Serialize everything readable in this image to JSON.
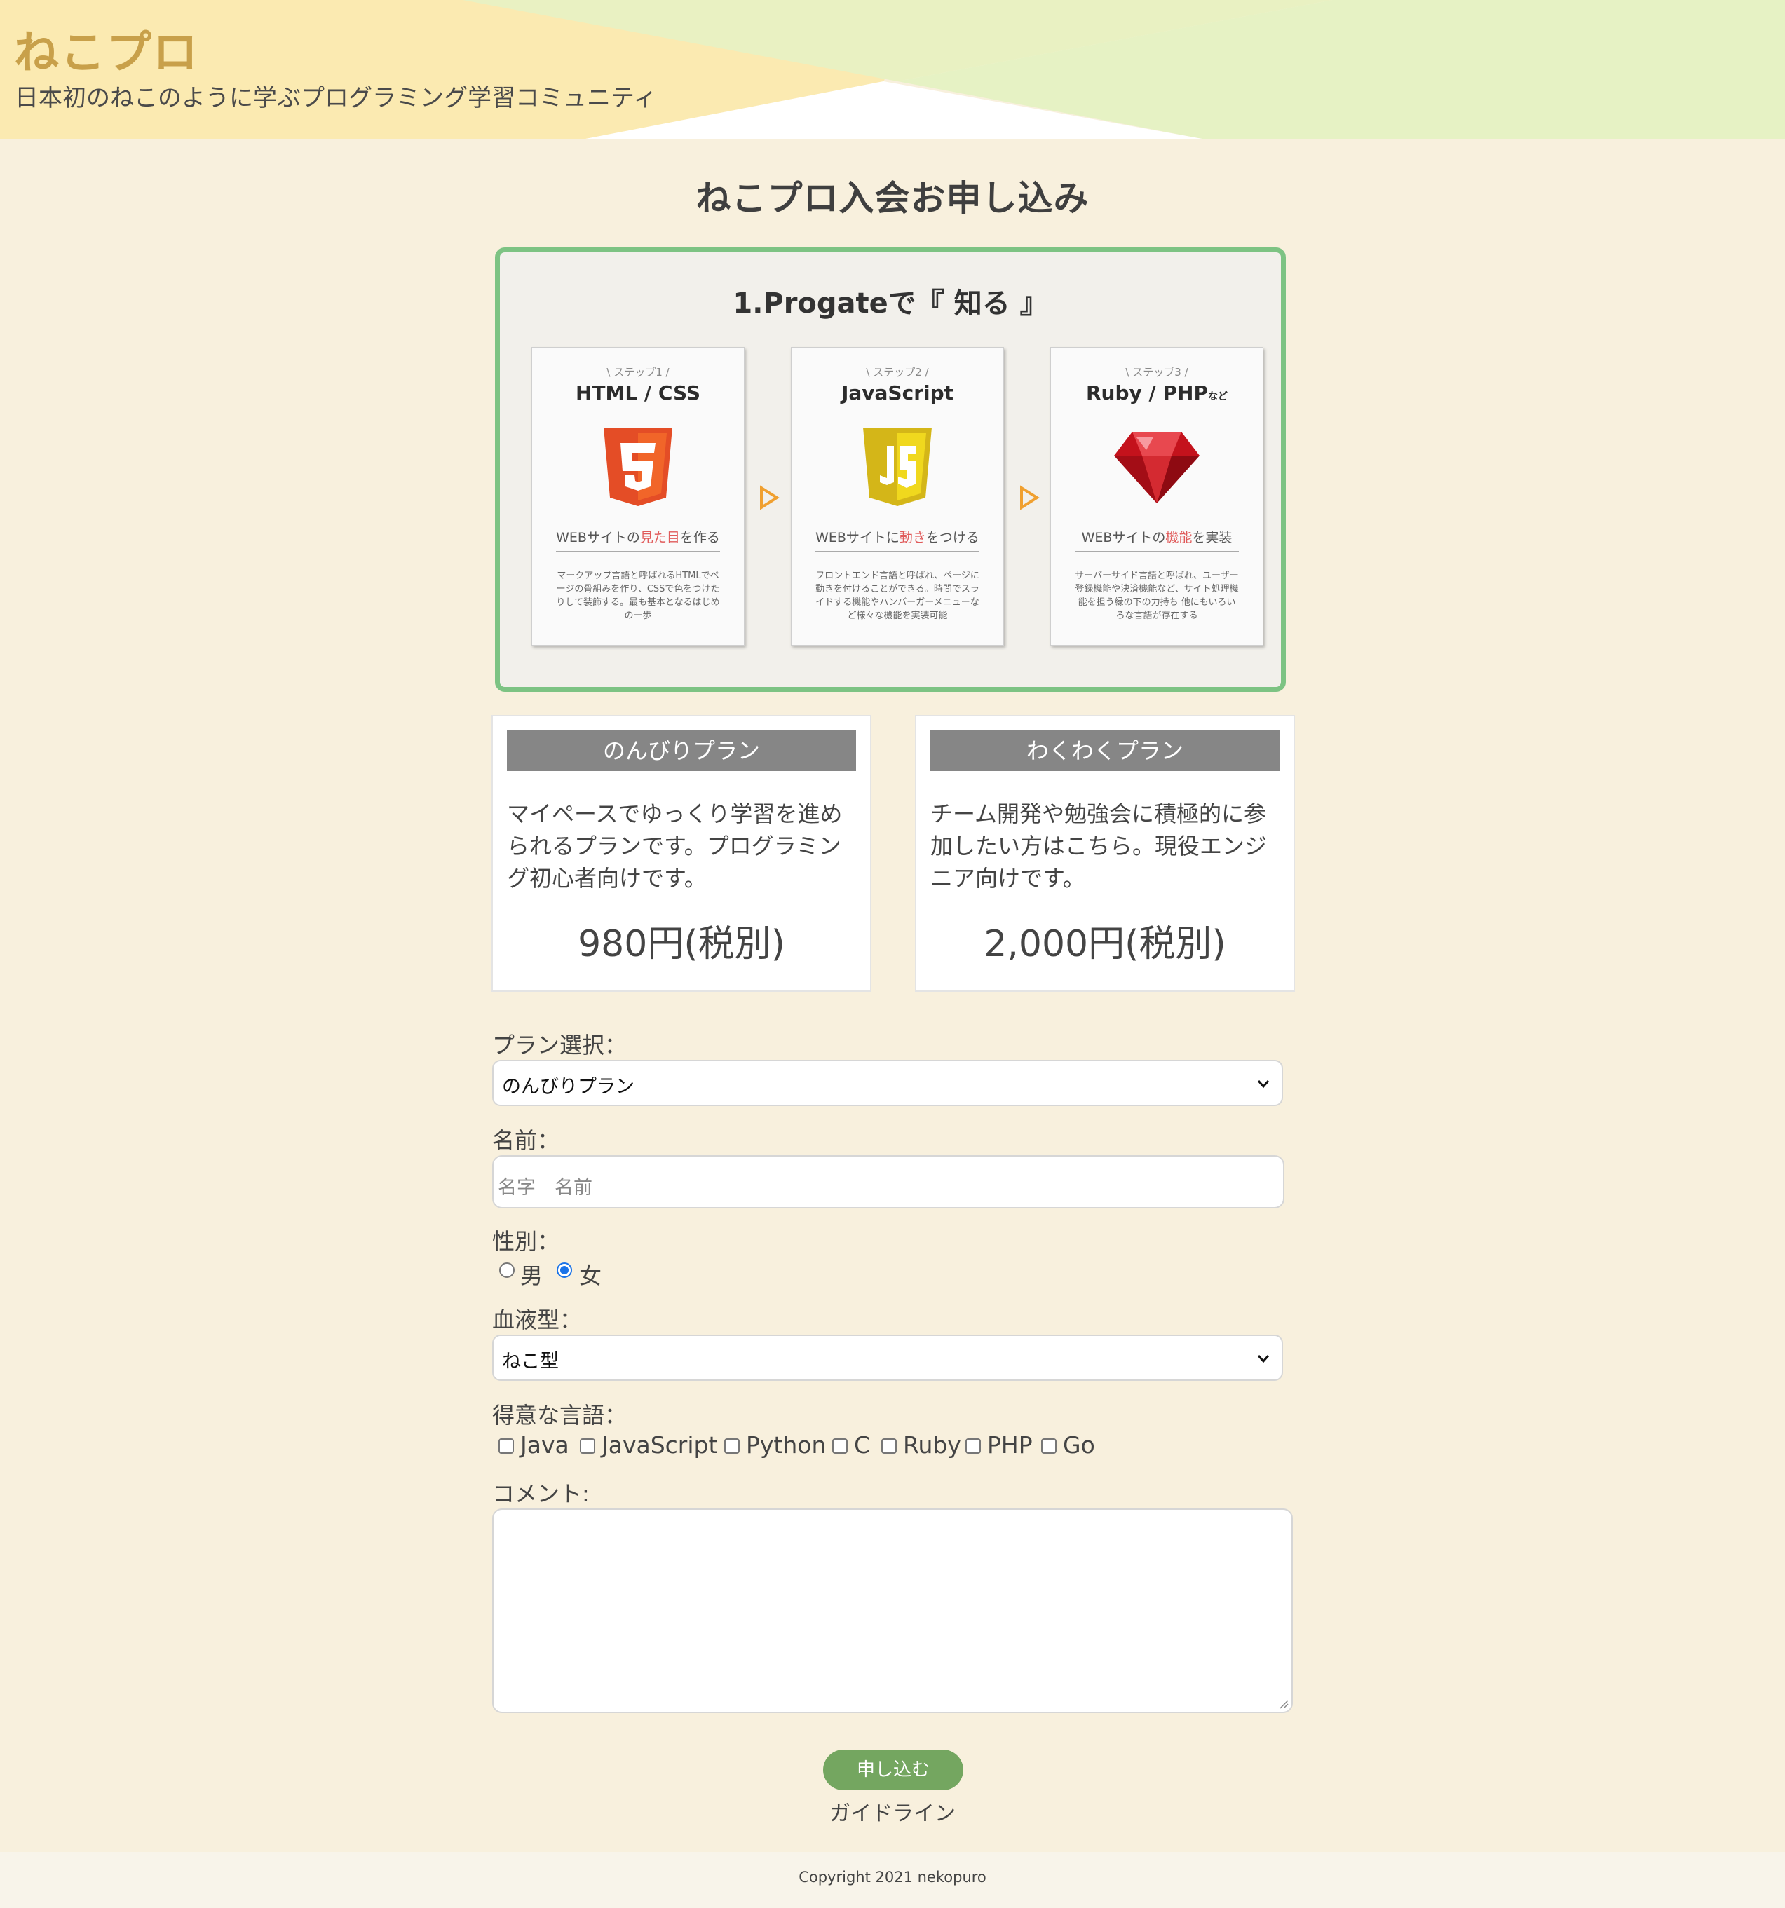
{
  "header": {
    "title": "ねこプロ",
    "tagline": "日本初のねこのように学ぶプログラミング学習コミュニティ"
  },
  "page_title": "ねこプロ入会お申し込み",
  "steps_panel": {
    "title": "1.Progateで『 知る 』",
    "cards": [
      {
        "sub": "\\ ステップ1 /",
        "name": "HTML / CSS",
        "logo_icon": "html5-icon",
        "tagline_pre": "WEBサイトの",
        "tagline_hl": "見た目",
        "tagline_post": "を作る",
        "desc": "マークアップ言語と呼ばれるHTMLでページの骨組みを作り、CSSで色をつけたりして装飾する。最も基本となるはじめの一歩"
      },
      {
        "sub": "\\ ステップ2 /",
        "name": "JavaScript",
        "logo_icon": "javascript-icon",
        "tagline_pre": "WEBサイトに",
        "tagline_hl": "動き",
        "tagline_post": "をつける",
        "desc": "フロントエンド言語と呼ばれ、ページに動きを付けることができる。時間でスライドする機能やハンバーガーメニューなど様々な機能を実装可能"
      },
      {
        "sub": "\\ ステップ3 /",
        "name": "Ruby / PHP",
        "name_suffix": "など",
        "logo_icon": "ruby-gem-icon",
        "tagline_pre": "WEBサイトの",
        "tagline_hl": "機能",
        "tagline_post": "を実装",
        "desc": "サーバーサイド言語と呼ばれ、ユーザー登録機能や決済機能など、サイト処理機能を担う縁の下の力持ち 他にもいろいろな言語が存在する"
      }
    ]
  },
  "plans": [
    {
      "name": "のんびりプラン",
      "desc": "マイペースでゆっくり学習を進められるプランです。プログラミング初心者向けです。",
      "price": "980円(税別)"
    },
    {
      "name": "わくわくプラン",
      "desc": "チーム開発や勉強会に積極的に参加したい方はこちら。現役エンジニア向けです。",
      "price": "2,000円(税別)"
    }
  ],
  "form": {
    "plan_label": "プラン選択：",
    "plan_selected": "のんびりプラン",
    "name_label": "名前：",
    "name_placeholder": "名字　名前",
    "gender_label": "性別：",
    "gender_options": [
      "男",
      "女"
    ],
    "gender_selected": "女",
    "blood_label": "血液型：",
    "blood_selected": "ねこ型",
    "lang_label": "得意な言語：",
    "languages": [
      "Java",
      "JavaScript",
      "Python",
      "C",
      "Ruby",
      "PHP",
      "Go"
    ],
    "comment_label": "コメント:",
    "submit_label": "申し込む",
    "guideline_label": "ガイドライン"
  },
  "footer": {
    "copyright": "Copyright 2021 nekopuro"
  },
  "colors": {
    "background": "#f8f0dd",
    "brand_title": "#c8a04a",
    "steps_border": "#7dc383",
    "plan_header": "#868686",
    "submit": "#74a660",
    "radio_checked": "#1a73e8"
  }
}
